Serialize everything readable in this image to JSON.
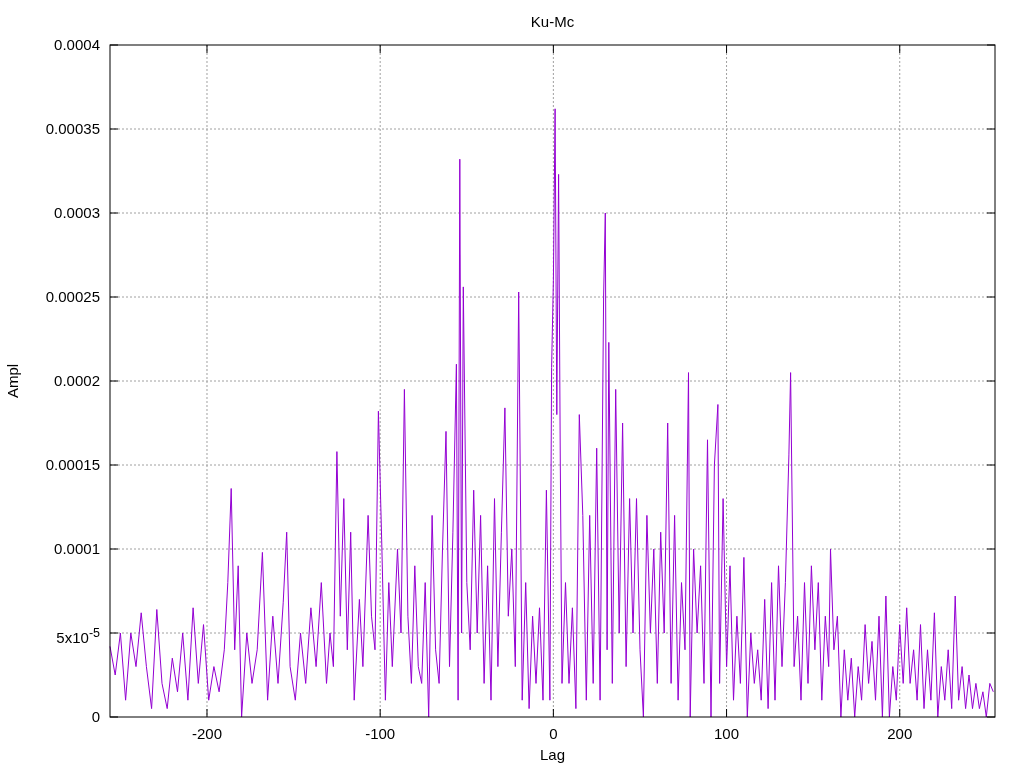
{
  "chart_data": {
    "type": "line",
    "title": "Ku-Mc",
    "xlabel": "Lag",
    "ylabel": "Ampl",
    "grid": true,
    "xlim": [
      -256,
      255
    ],
    "ylim": [
      0,
      0.0004
    ],
    "xticks": [
      -200,
      -100,
      0,
      100,
      200
    ],
    "yticks": [
      0,
      {
        "value": 5e-05,
        "label": "5x10$^{-5}$"
      },
      0.0001,
      0.00015,
      0.0002,
      0.00025,
      0.0003,
      0.00035,
      0.0004
    ],
    "x": [
      -256,
      -253,
      -250,
      -247,
      -244,
      -241,
      -238,
      -235,
      -232,
      -229,
      -226,
      -223,
      -220,
      -217,
      -214,
      -211,
      -208,
      -205,
      -202,
      -199,
      -196,
      -193,
      -190,
      -188,
      -186,
      -184,
      -182,
      -180,
      -177,
      -174,
      -171,
      -168,
      -165,
      -162,
      -159,
      -156,
      -154,
      -152,
      -149,
      -146,
      -143,
      -140,
      -137,
      -134,
      -131,
      -129,
      -127,
      -125,
      -123,
      -121,
      -119,
      -117,
      -115,
      -112,
      -110,
      -107,
      -105,
      -103,
      -101,
      -99,
      -97,
      -95,
      -93,
      -90,
      -88,
      -86,
      -84,
      -82,
      -80,
      -78,
      -76,
      -74,
      -72,
      -70,
      -68,
      -66,
      -64,
      -62,
      -60,
      -58,
      -56,
      -55,
      -54,
      -53,
      -52,
      -50,
      -48,
      -46,
      -44,
      -42,
      -40,
      -38,
      -36,
      -34,
      -32,
      -30,
      -28,
      -26,
      -24,
      -22,
      -20,
      -18,
      -16,
      -14,
      -12,
      -10,
      -8,
      -6,
      -4,
      -2,
      -1,
      0,
      1,
      2,
      3,
      4,
      5,
      7,
      9,
      11,
      13,
      15,
      17,
      19,
      21,
      23,
      25,
      27,
      29,
      30,
      31,
      32,
      34,
      36,
      38,
      40,
      42,
      44,
      46,
      48,
      50,
      52,
      54,
      56,
      58,
      60,
      62,
      64,
      66,
      68,
      70,
      72,
      74,
      76,
      78,
      79,
      81,
      83,
      85,
      87,
      89,
      91,
      93,
      95,
      96,
      98,
      100,
      102,
      104,
      106,
      108,
      110,
      112,
      114,
      116,
      118,
      120,
      122,
      124,
      126,
      128,
      130,
      132,
      134,
      136,
      137,
      139,
      141,
      143,
      145,
      147,
      149,
      151,
      153,
      155,
      157,
      159,
      160,
      162,
      164,
      166,
      168,
      170,
      172,
      174,
      176,
      178,
      180,
      182,
      184,
      186,
      188,
      190,
      192,
      194,
      196,
      198,
      200,
      202,
      204,
      206,
      208,
      210,
      212,
      214,
      216,
      218,
      220,
      222,
      224,
      226,
      228,
      230,
      232,
      234,
      236,
      238,
      240,
      242,
      244,
      246,
      248,
      250,
      252,
      254
    ],
    "series": [
      {
        "color": "#9400d3",
        "values": [
          4.2e-05,
          2.5e-05,
          5e-05,
          1e-05,
          5e-05,
          3e-05,
          6.2e-05,
          3e-05,
          5e-06,
          6.4e-05,
          2e-05,
          5e-06,
          3.5e-05,
          1.5e-05,
          5e-05,
          1e-05,
          6.5e-05,
          2e-05,
          5.5e-05,
          1e-05,
          3e-05,
          1.5e-05,
          4e-05,
          8e-05,
          0.000136,
          4e-05,
          9e-05,
          0,
          5e-05,
          2e-05,
          4e-05,
          9.8e-05,
          1e-05,
          6e-05,
          2e-05,
          6.8e-05,
          0.00011,
          3e-05,
          1e-05,
          5e-05,
          2e-05,
          6.5e-05,
          3e-05,
          8e-05,
          2e-05,
          5e-05,
          3e-05,
          0.000158,
          6e-05,
          0.00013,
          4e-05,
          0.00011,
          1e-05,
          7e-05,
          3e-05,
          0.00012,
          6e-05,
          4e-05,
          0.000182,
          0.0001,
          1e-05,
          8e-05,
          3e-05,
          0.0001,
          5e-05,
          0.000195,
          6e-05,
          2e-05,
          9e-05,
          3e-05,
          2e-05,
          8e-05,
          0,
          0.00012,
          4e-05,
          2e-05,
          0.0001,
          0.00017,
          3e-05,
          0.00011,
          0.00021,
          1e-05,
          0.000332,
          5e-05,
          0.000256,
          8e-05,
          4e-05,
          0.000135,
          5e-05,
          0.00012,
          2e-05,
          9e-05,
          1e-05,
          0.00013,
          3e-05,
          0.00011,
          0.000184,
          6e-05,
          0.0001,
          3e-05,
          0.000253,
          1e-05,
          8e-05,
          5e-06,
          6e-05,
          2e-05,
          6.5e-05,
          1e-05,
          0.000135,
          1e-05,
          0.000208,
          0.00026,
          0.000362,
          0.00018,
          0.000323,
          0.00015,
          2e-05,
          8e-05,
          2e-05,
          6.5e-05,
          5e-06,
          0.00018,
          0.00012,
          1e-05,
          0.00012,
          2e-05,
          0.00016,
          1e-05,
          0.00025,
          0.0003,
          4e-05,
          0.000223,
          2e-05,
          0.000195,
          5e-05,
          0.000175,
          3e-05,
          0.00013,
          5e-05,
          0.00013,
          4e-05,
          0,
          0.00012,
          5e-05,
          0.0001,
          2e-05,
          0.00011,
          5e-05,
          0.000175,
          2e-05,
          0.00012,
          1e-05,
          8e-05,
          4e-05,
          0.000205,
          0,
          0.0001,
          5e-05,
          9e-05,
          2e-05,
          0.000165,
          0,
          0.00015,
          0.000186,
          2e-05,
          0.00013,
          3e-05,
          9e-05,
          1e-05,
          6e-05,
          2e-05,
          9.5e-05,
          0,
          5e-05,
          2e-05,
          4e-05,
          1e-05,
          7e-05,
          5e-06,
          8e-05,
          1e-05,
          9e-05,
          3e-05,
          8e-05,
          0.000156,
          0.000205,
          3e-05,
          6e-05,
          1e-05,
          8e-05,
          2e-05,
          9e-05,
          4e-05,
          8e-05,
          1e-05,
          6e-05,
          3e-05,
          0.0001,
          4e-05,
          6e-05,
          0,
          4e-05,
          1e-05,
          3.5e-05,
          0,
          3e-05,
          1e-05,
          5.5e-05,
          2e-05,
          4.5e-05,
          1e-05,
          6e-05,
          0,
          7.2e-05,
          0,
          3e-05,
          1e-05,
          5.5e-05,
          2e-05,
          6.5e-05,
          2e-05,
          4e-05,
          1e-05,
          5.5e-05,
          5e-06,
          4e-05,
          1e-05,
          6.2e-05,
          0,
          3e-05,
          1e-05,
          4e-05,
          5e-06,
          7.2e-05,
          1e-05,
          3e-05,
          5e-06,
          2.5e-05,
          5e-06,
          2e-05,
          5e-06,
          1.5e-05,
          0,
          2e-05,
          1.5e-05
        ]
      }
    ]
  }
}
